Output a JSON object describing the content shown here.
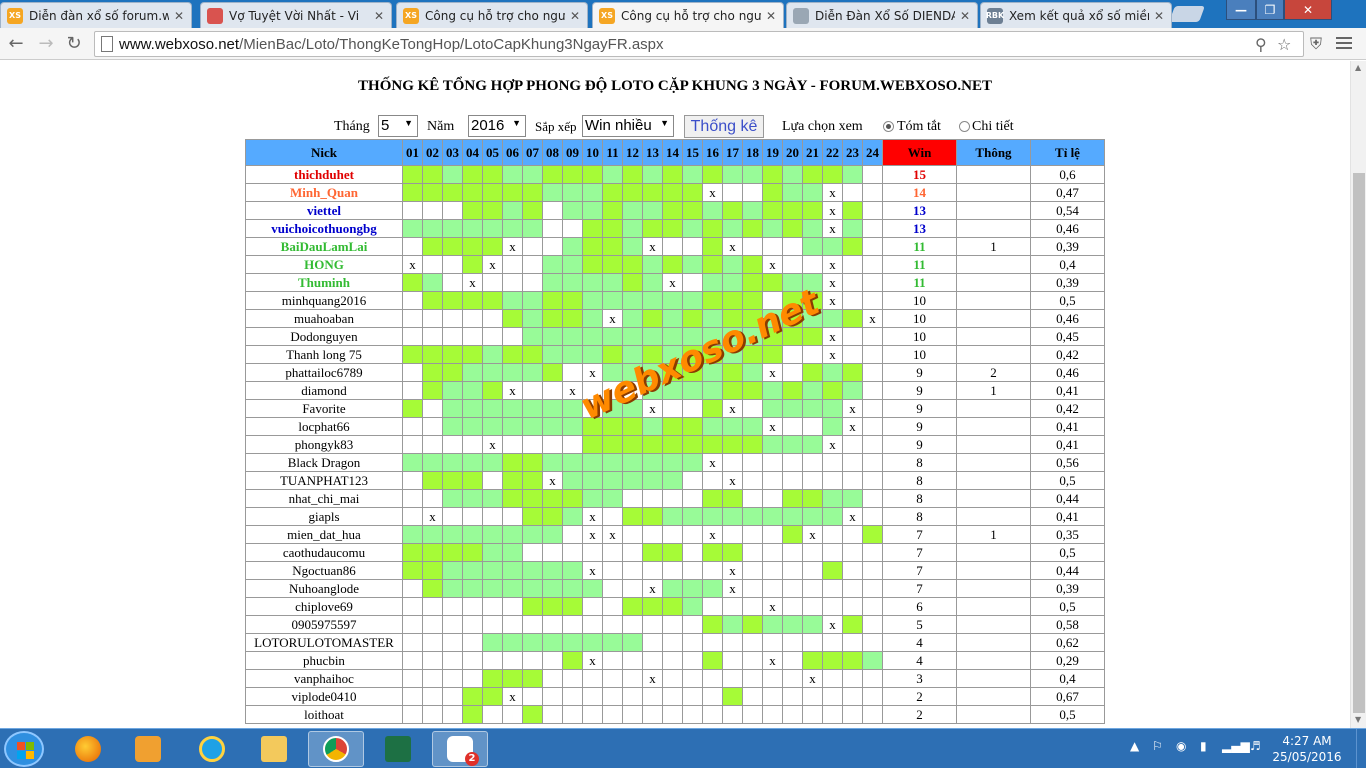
{
  "browser": {
    "tabs": [
      {
        "title": "Diễn đàn xổ số forum.web",
        "favicon": "XS",
        "color": "#f5a623"
      },
      {
        "title": "Vợ Tuyệt Vời Nhất - Vi",
        "favicon": "",
        "color": "#d9534f"
      },
      {
        "title": "Công cụ hỗ trợ cho người",
        "favicon": "XS",
        "color": "#f5a623"
      },
      {
        "title": "Công cụ hỗ trợ cho người",
        "favicon": "XS",
        "color": "#f5a623"
      },
      {
        "title": "Diễn Đàn Xổ Số DIENDAN",
        "favicon": "",
        "color": "#9aa7b4"
      },
      {
        "title": "Xem kết quả xổ số miền B",
        "favicon": "RBK",
        "color": "#6d7f93"
      }
    ],
    "url_host": "www.webxoso.net",
    "url_path": "/MienBac/Loto/ThongKeTongHop/LotoCapKhung3NgayFR.aspx"
  },
  "page": {
    "title": "THỐNG KÊ TỔNG HỢP PHONG ĐỘ LOTO CẶP KHUNG 3 NGÀY - FORUM.WEBXOSO.NET",
    "filters": {
      "month_label": "Tháng",
      "month_value": "5",
      "year_label": "Năm",
      "year_value": "2016",
      "sort_label": "Sắp xếp",
      "sort_value": "Win nhiều",
      "submit_label": "Thống kê",
      "view_label": "Lựa chọn xem",
      "view_summary": "Tóm tắt",
      "view_detail": "Chi tiết"
    },
    "watermark": "webxoso.net"
  },
  "table": {
    "headers": {
      "nick": "Nick",
      "win": "Win",
      "thong": "Thông",
      "tile": "Tỉ lệ"
    },
    "days": [
      "01",
      "02",
      "03",
      "04",
      "05",
      "06",
      "07",
      "08",
      "09",
      "10",
      "11",
      "12",
      "13",
      "14",
      "15",
      "16",
      "17",
      "18",
      "19",
      "20",
      "21",
      "22",
      "23",
      "24"
    ],
    "rows": [
      {
        "nick": "thichduhet",
        "style": "red",
        "win": "15",
        "thong": "",
        "tile": "0,6",
        "cells": "112112211121212122121120"
      },
      {
        "nick": "Minh_Quan",
        "style": "orange",
        "win": "14",
        "thong": "",
        "tile": "0,47",
        "cells": "111111122211111x00122x00"
      },
      {
        "nick": "viettel",
        "style": "blue",
        "win": "13",
        "thong": "",
        "tile": "0,54",
        "cells": "000112102212211212111x10"
      },
      {
        "nick": "vuichoicothuongbg",
        "style": "blue",
        "win": "13",
        "thong": "",
        "tile": "0,46",
        "cells": "222222200112112121212x20"
      },
      {
        "nick": "BaiDauLamLai",
        "style": "green",
        "win": "11",
        "thong": "1",
        "tile": "0,39",
        "cells": "01111x002112x001x0002210"
      },
      {
        "nick": "HONG",
        "style": "green",
        "win": "11",
        "thong": "",
        "tile": "0,4",
        "cells": "x001x0022111212121x00x00"
      },
      {
        "nick": "Thuminh",
        "style": "green",
        "win": "11",
        "thong": "",
        "tile": "0,39",
        "cells": "120x000222212x0221122x00"
      },
      {
        "nick": "minhquang2016",
        "style": "",
        "win": "10",
        "thong": "",
        "tile": "0,5",
        "cells": "011112211222222111011x00"
      },
      {
        "nick": "muahoaban",
        "style": "",
        "win": "10",
        "thong": "",
        "tile": "0,46",
        "cells": "0000012112x212121121221x"
      },
      {
        "nick": "Dodonguyen",
        "style": "",
        "win": "10",
        "thong": "",
        "tile": "0,45",
        "cells": "000000222222222222111x00"
      },
      {
        "nick": "Thanh long 75",
        "style": "",
        "win": "10",
        "thong": "",
        "tile": "0,42",
        "cells": "111121122212121121100x00"
      },
      {
        "nick": "phattailoc6789",
        "style": "",
        "win": "9",
        "thong": "2",
        "tile": "0,46",
        "cells": "011222210x22211212x01210"
      },
      {
        "nick": "diamond",
        "style": "",
        "win": "9",
        "thong": "1",
        "tile": "0,41",
        "cells": "01221x00x000222211212120"
      },
      {
        "nick": "Favorite",
        "style": "",
        "win": "9",
        "thong": "",
        "tile": "0,42",
        "cells": "102222222x22x001x02222x0"
      },
      {
        "nick": "locphat66",
        "style": "",
        "win": "9",
        "thong": "",
        "tile": "0,41",
        "cells": "002222222111211222x002x0"
      },
      {
        "nick": "phongyk83",
        "style": "",
        "win": "9",
        "thong": "",
        "tile": "0,41",
        "cells": "0000x0000111111111222x00"
      },
      {
        "nick": "Black Dragon",
        "style": "",
        "win": "8",
        "thong": "",
        "tile": "0,56",
        "cells": "222221122222222x00000000"
      },
      {
        "nick": "TUANPHAT123",
        "style": "",
        "win": "8",
        "thong": "",
        "tile": "0,5",
        "cells": "0111011x22222200x0000000"
      },
      {
        "nick": "nhat_chi_mai",
        "style": "",
        "win": "8",
        "thong": "",
        "tile": "0,44",
        "cells": "00222111122000011001122"
      },
      {
        "nick": "giapls",
        "style": "",
        "win": "8",
        "thong": "",
        "tile": "0,41",
        "cells": "0x0000112x011222222222x0"
      },
      {
        "nick": "mien_dat_hua",
        "style": "",
        "win": "7",
        "thong": "1",
        "tile": "0,35",
        "cells": "222222220xx0000x0001x001"
      },
      {
        "nick": "caothudaucomu",
        "style": "",
        "win": "7",
        "thong": "",
        "tile": "0,5",
        "cells": "111122000000110110000000"
      },
      {
        "nick": "Ngoctuan86",
        "style": "",
        "win": "7",
        "thong": "",
        "tile": "0,44",
        "cells": "112222222x000000x0000100"
      },
      {
        "nick": "Nuhoanglode",
        "style": "",
        "win": "7",
        "thong": "",
        "tile": "0,39",
        "cells": "012222222200x222x0000000"
      },
      {
        "nick": "chiplove69",
        "style": "",
        "win": "6",
        "thong": "",
        "tile": "0,5",
        "cells": "000000111001112000x00000"
      },
      {
        "nick": "0905975597",
        "style": "",
        "win": "5",
        "thong": "",
        "tile": "0,58",
        "cells": "000000000000000121222x10"
      },
      {
        "nick": "LOTORULOTOMASTER",
        "style": "",
        "win": "4",
        "thong": "",
        "tile": "0,62",
        "cells": "000022222222000000000000"
      },
      {
        "nick": "phucbin",
        "style": "",
        "win": "4",
        "thong": "",
        "tile": "0,29",
        "cells": "000000001x00000100x01112x0"
      },
      {
        "nick": "vanphaihoc",
        "style": "",
        "win": "3",
        "thong": "",
        "tile": "0,4",
        "cells": "000011100000x0000000x000"
      },
      {
        "nick": "viplode0410",
        "style": "",
        "win": "2",
        "thong": "",
        "tile": "0,67",
        "cells": "00011x00000000001000000"
      },
      {
        "nick": "loithoat",
        "style": "",
        "win": "2",
        "thong": "",
        "tile": "0,5",
        "cells": "000100100000000000000000"
      }
    ]
  },
  "taskbar": {
    "time": "4:27 AM",
    "date": "25/05/2016",
    "zalo_badge": "2"
  }
}
